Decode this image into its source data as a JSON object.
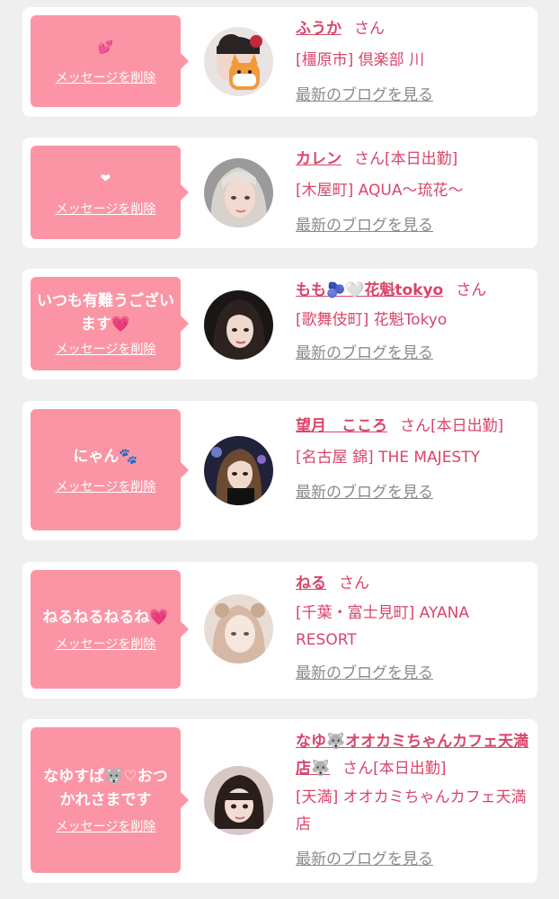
{
  "entries": [
    {
      "message": "💕",
      "delete_label": "メッセージを削除",
      "name": "ふうか",
      "honorific": "さん",
      "status": "",
      "shop": "[橿原市] 倶楽部 川",
      "blog_label": "最新のブログを見る",
      "avatar_icon": "cat-sticker-avatar"
    },
    {
      "message": "❤",
      "delete_label": "メッセージを削除",
      "name": "カレン",
      "honorific": "さん",
      "status": "[本日出勤]",
      "shop": "[木屋町] AQUA〜琉花〜",
      "blog_label": "最新のブログを見る",
      "avatar_icon": "blonde-portrait-avatar"
    },
    {
      "message": "いつも有難うございます💗",
      "delete_label": "メッセージを削除",
      "name": "もも🫐🤍花魁tokyo",
      "honorific": "さん",
      "status": "",
      "shop": "[歌舞伎町] 花魁Tokyo",
      "blog_label": "最新のブログを見る",
      "avatar_icon": "dark-hair-portrait-avatar"
    },
    {
      "message": "にゃん🐾",
      "delete_label": "メッセージを削除",
      "name": "望月　こころ",
      "honorific": "さん",
      "status": "[本日出勤]",
      "shop": "[名古屋 錦] THE MAJESTY",
      "blog_label": "最新のブログを見る",
      "avatar_icon": "party-portrait-avatar"
    },
    {
      "message": "ねるねるねるね💗",
      "delete_label": "メッセージを削除",
      "name": "ねる",
      "honorific": "さん",
      "status": "",
      "shop": "[千葉・富士見町] AYANA RESORT",
      "blog_label": "最新のブログを見る",
      "avatar_icon": "soft-portrait-avatar"
    },
    {
      "message": "なゆすぱ🐺♡おつかれさまです",
      "delete_label": "メッセージを削除",
      "name": "なゆ🐺オオカミちゃんカフェ天満店🐺",
      "honorific": "さん",
      "status": "[本日出勤]",
      "shop": "[天満] オオカミちゃんカフェ天満店",
      "blog_label": "最新のブログを見る",
      "avatar_icon": "bob-hair-portrait-avatar"
    }
  ],
  "colors": {
    "accent": "#d9456a",
    "bubble": "#fb95a5",
    "link_gray": "#8a8a8a",
    "background": "#efefef"
  }
}
